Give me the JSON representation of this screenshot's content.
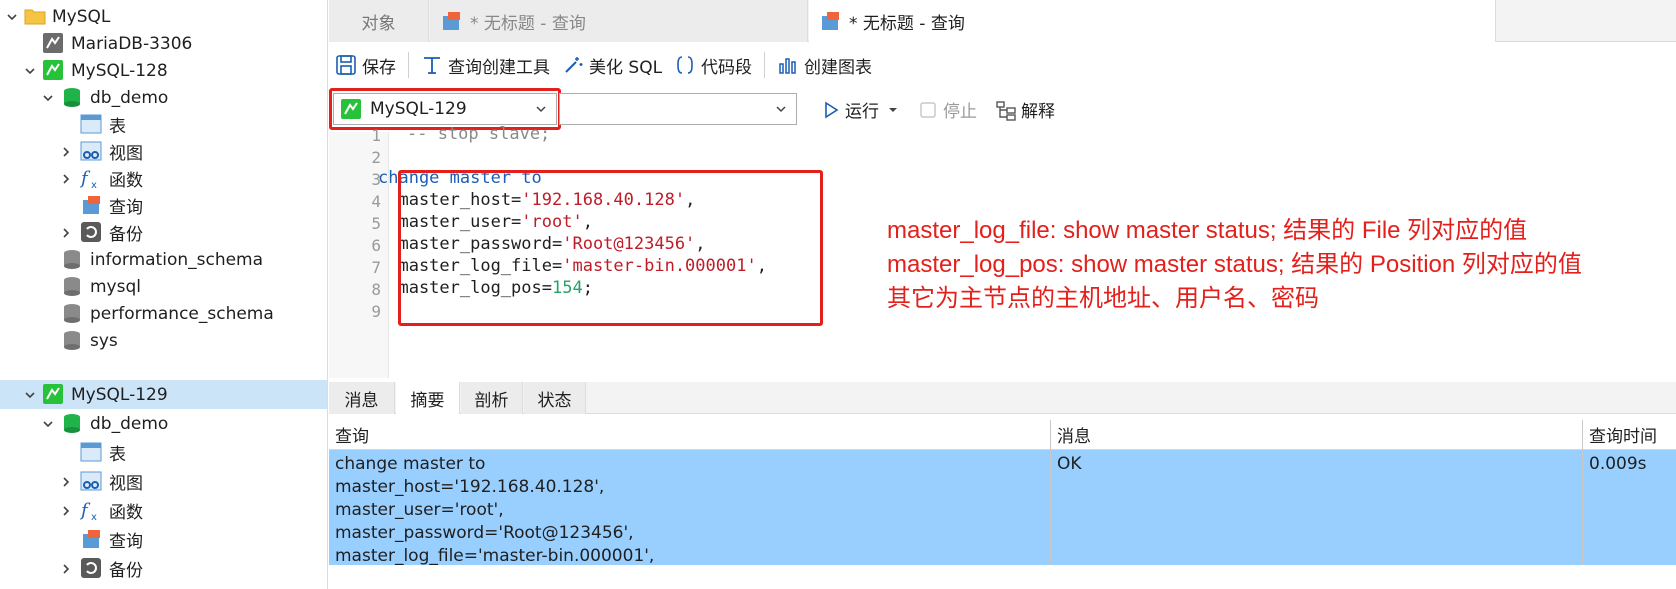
{
  "sidebar": {
    "items": [
      {
        "label": "MySQL",
        "icon": "folder-icon"
      },
      {
        "label": "MariaDB-3306",
        "icon": "mariadb-connection-icon"
      },
      {
        "label": "MySQL-128",
        "icon": "mysql-connection-icon"
      },
      {
        "label": "db_demo",
        "icon": "database-icon"
      },
      {
        "label": "表",
        "icon": "table-icon"
      },
      {
        "label": "视图",
        "icon": "view-icon"
      },
      {
        "label": "函数",
        "icon": "function-icon"
      },
      {
        "label": "查询",
        "icon": "query-icon"
      },
      {
        "label": "备份",
        "icon": "backup-icon"
      },
      {
        "label": "information_schema",
        "icon": "database-icon"
      },
      {
        "label": "mysql",
        "icon": "database-icon"
      },
      {
        "label": "performance_schema",
        "icon": "database-icon"
      },
      {
        "label": "sys",
        "icon": "database-icon"
      },
      {
        "label": "MySQL-129",
        "icon": "mysql-connection-icon"
      },
      {
        "label": "db_demo",
        "icon": "database-icon"
      },
      {
        "label": "表",
        "icon": "table-icon"
      },
      {
        "label": "视图",
        "icon": "view-icon"
      },
      {
        "label": "函数",
        "icon": "function-icon"
      },
      {
        "label": "查询",
        "icon": "query-icon"
      },
      {
        "label": "备份",
        "icon": "backup-icon"
      }
    ]
  },
  "tabs": {
    "objects": "对象",
    "tab1": "* 无标题 - 查询",
    "tab2": "* 无标题 - 查询"
  },
  "toolbar": {
    "save": "保存",
    "query_builder": "查询创建工具",
    "beautify": "美化 SQL",
    "snippet": "代码段",
    "create_chart": "创建图表"
  },
  "connection": {
    "selected": "MySQL-129",
    "database": "",
    "run": "运行",
    "stop": "停止",
    "explain": "解释"
  },
  "editor": {
    "line_numbers": [
      "1",
      "2",
      "3",
      "4",
      "5",
      "6",
      "7",
      "8",
      "9"
    ],
    "lines": {
      "l1": "-- stop slave;",
      "l3_kw": "change master to",
      "l4_a": "  master_host=",
      "l4_s": "'192.168.40.128'",
      "l4_b": ",",
      "l5_a": "  master_user=",
      "l5_s": "'root'",
      "l5_b": ",",
      "l6_a": "  master_password=",
      "l6_s": "'Root@123456'",
      "l6_b": ",",
      "l7_a": "  master_log_file=",
      "l7_s": "'master-bin.000001'",
      "l7_b": ",",
      "l8_a": "  master_log_pos=",
      "l8_n": "154",
      "l8_b": ";"
    },
    "annotations": [
      "master_log_file: show master status; 结果的 File 列对应的值",
      "master_log_pos: show master status; 结果的 Position 列对应的值",
      "其它为主节点的主机地址、用户名、密码"
    ]
  },
  "results": {
    "tabs": [
      "消息",
      "摘要",
      "剖析",
      "状态"
    ],
    "active_tab": "摘要",
    "columns": [
      "查询",
      "消息",
      "查询时间"
    ],
    "row": {
      "query_lines": [
        "change master to",
        "master_host='192.168.40.128',",
        "master_user='root',",
        "master_password='Root@123456',",
        "master_log_file='master-bin.000001',"
      ],
      "message": "OK",
      "time": "0.009s"
    }
  },
  "colors": {
    "highlight_red": "#e3201b",
    "selected_row": "#99cfff",
    "sidebar_selected": "#cce4f7",
    "keyword": "#1a5fb4",
    "string": "#c01c28",
    "number": "#26a269"
  }
}
